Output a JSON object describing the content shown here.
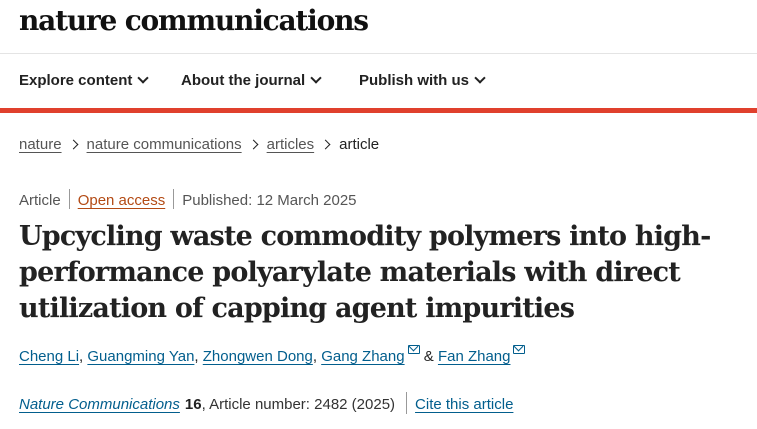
{
  "brand": {
    "logo_text": "nature communications"
  },
  "nav": {
    "items": [
      {
        "label": "Explore content"
      },
      {
        "label": "About the journal"
      },
      {
        "label": "Publish with us"
      }
    ]
  },
  "breadcrumb": {
    "items": [
      "nature",
      "nature communications",
      "articles",
      "article"
    ]
  },
  "meta": {
    "type": "Article",
    "access": "Open access",
    "published": "Published: 12 March 2025"
  },
  "article": {
    "title": "Upcycling waste commodity polymers into high-performance polyarylate materials with direct utilization of capping agent impurities"
  },
  "authors": {
    "list": [
      "Cheng Li",
      "Guangming Yan",
      "Zhongwen Dong",
      "Gang Zhang",
      "Fan Zhang"
    ],
    "separator": ", ",
    "and_text": " & "
  },
  "citation": {
    "journal": "Nature Communications",
    "volume": "16",
    "rest": ", Article number: 2482 (2025)",
    "cite_label": "Cite this article"
  },
  "colors": {
    "accent_red": "#e0402d",
    "link_blue": "#025e8d",
    "open_access": "#b34a14"
  },
  "icons": {
    "nav_chevron": "chevron-down-icon",
    "breadcrumb_sep": "chevron-right-icon",
    "email": "mail-icon"
  }
}
